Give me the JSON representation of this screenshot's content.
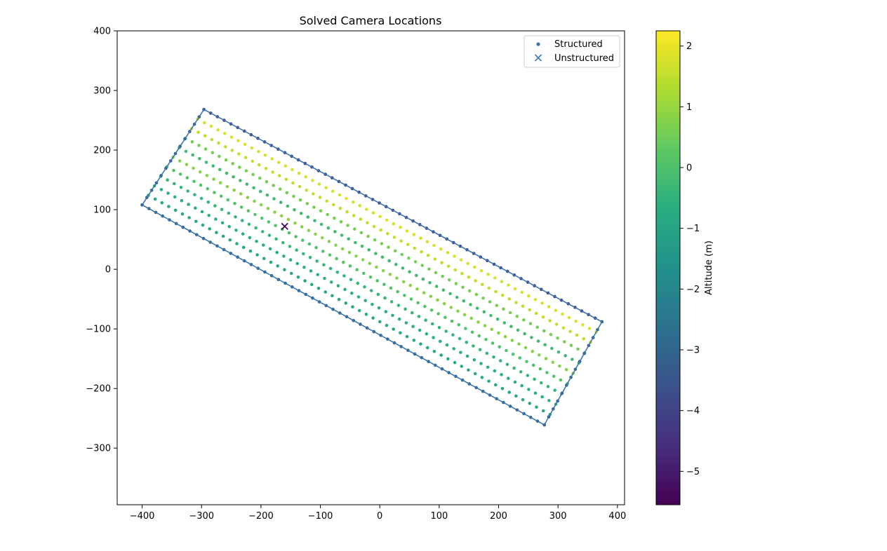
{
  "chart_data": {
    "type": "scatter",
    "title": "Solved Camera Locations",
    "xlabel": "",
    "ylabel": "",
    "xlim": [
      -442,
      412
    ],
    "ylim": [
      -395,
      400
    ],
    "xticks": [
      -400,
      -300,
      -200,
      -100,
      0,
      100,
      200,
      300,
      400
    ],
    "yticks": [
      -300,
      -200,
      -100,
      0,
      100,
      200,
      300,
      400
    ],
    "xtick_labels": [
      "−400",
      "−300",
      "−200",
      "−100",
      "0",
      "100",
      "200",
      "300",
      "400"
    ],
    "ytick_labels": [
      "−300",
      "−200",
      "−100",
      "0",
      "100",
      "200",
      "300",
      "400"
    ],
    "grid": false,
    "legend": {
      "position": "top-right",
      "entries": [
        {
          "label": "Structured",
          "marker": "dot"
        },
        {
          "label": "Unstructured",
          "marker": "x"
        }
      ]
    },
    "boundary": {
      "color": "#3b75af",
      "corners": [
        [
          -296,
          268
        ],
        [
          374,
          -88
        ],
        [
          277,
          -261
        ],
        [
          -400,
          108
        ]
      ]
    },
    "series": [
      {
        "name": "Structured",
        "marker": "dot",
        "pattern": {
          "corners": [
            [
              -296,
              268
            ],
            [
              374,
              -88
            ],
            [
              277,
              -261
            ],
            [
              -400,
              108
            ]
          ],
          "lines": 11,
          "points_per_line": 60,
          "edge_altitude": -3.2,
          "long_edge_altitudes": [
            -3.0,
            -4.0
          ],
          "line_altitudes": [
            0.3,
            1.8,
            1.5,
            0.6,
            -0.2,
            0.8,
            0.1,
            -0.4,
            -0.6,
            -0.8,
            -1.0
          ]
        }
      },
      {
        "name": "Unstructured",
        "marker": "x",
        "points": [
          {
            "x": -160,
            "y": 72,
            "altitude": -5.5
          }
        ]
      }
    ],
    "colorbar": {
      "label": "Altitude (m)",
      "colormap": "viridis",
      "range": [
        -5.55,
        2.25
      ],
      "ticks": [
        2,
        1,
        0,
        -1,
        -2,
        -3,
        -4,
        -5
      ],
      "tick_labels": [
        "2",
        "1",
        "0",
        "−1",
        "−2",
        "−3",
        "−4",
        "−5"
      ]
    }
  }
}
